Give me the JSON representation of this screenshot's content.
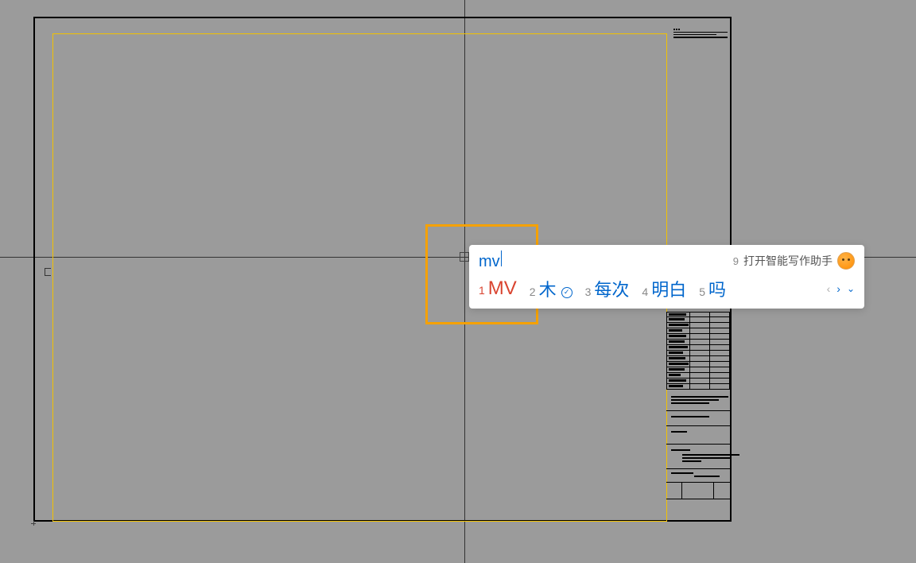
{
  "ime": {
    "input": "mv",
    "hint_number": "9",
    "hint_text": "打开智能写作助手",
    "candidates": [
      {
        "num": "1",
        "text": "MV",
        "selected": true,
        "badge": false
      },
      {
        "num": "2",
        "text": "木",
        "selected": false,
        "badge": true
      },
      {
        "num": "3",
        "text": "每次",
        "selected": false,
        "badge": false
      },
      {
        "num": "4",
        "text": "明白",
        "selected": false,
        "badge": false
      },
      {
        "num": "5",
        "text": "吗",
        "selected": false,
        "badge": false
      }
    ],
    "nav": {
      "prev": "‹",
      "next": "›",
      "expand": "⌄"
    }
  }
}
